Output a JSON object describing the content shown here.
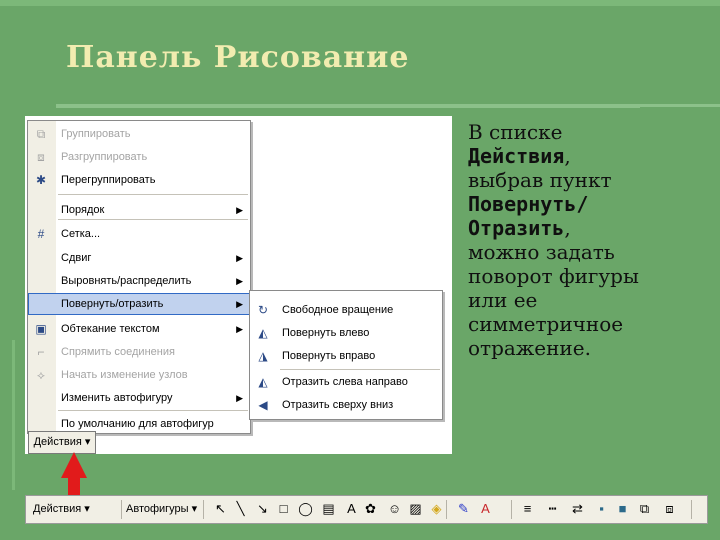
{
  "slide": {
    "title": "Панель Рисование",
    "description_lines": [
      {
        "text": "В списке",
        "bold": false
      },
      {
        "text": "Действия",
        "bold": true,
        "suffix": ","
      },
      {
        "text": "выбрав пункт",
        "bold": false
      },
      {
        "text": "Повернуть/",
        "bold": true
      },
      {
        "text": "Отразить",
        "bold": true,
        "suffix": ","
      },
      {
        "text": "можно задать",
        "bold": false
      },
      {
        "text": "поворот фигуры",
        "bold": false
      },
      {
        "text": "или ее",
        "bold": false
      },
      {
        "text": "симметричное",
        "bold": false
      },
      {
        "text": "отражение.",
        "bold": false
      }
    ]
  },
  "menu": {
    "items": [
      {
        "label": "Группировать",
        "icon": "group-icon",
        "glyph": "⧉",
        "disabled": true,
        "arrow": false
      },
      {
        "label": "Разгруппировать",
        "icon": "ungroup-icon",
        "glyph": "⧈",
        "disabled": true,
        "arrow": false
      },
      {
        "label": "Перегруппировать",
        "icon": "regroup-icon",
        "glyph": "✱",
        "disabled": false,
        "arrow": false
      },
      {
        "label": "Порядок",
        "icon": "",
        "glyph": "",
        "disabled": false,
        "arrow": true
      },
      {
        "label": "Сетка...",
        "icon": "grid-icon",
        "glyph": "#",
        "disabled": false,
        "arrow": false
      },
      {
        "label": "Сдвиг",
        "icon": "",
        "glyph": "",
        "disabled": false,
        "arrow": true
      },
      {
        "label": "Выровнять/распределить",
        "icon": "",
        "glyph": "",
        "disabled": false,
        "arrow": true
      },
      {
        "label": "Повернуть/отразить",
        "icon": "",
        "glyph": "",
        "disabled": false,
        "arrow": true,
        "highlighted": true
      },
      {
        "label": "Обтекание текстом",
        "icon": "text-wrap-icon",
        "glyph": "▣",
        "disabled": false,
        "arrow": true
      },
      {
        "label": "Спрямить соединения",
        "icon": "straighten-connectors-icon",
        "glyph": "⌐",
        "disabled": true,
        "arrow": false
      },
      {
        "label": "Начать изменение узлов",
        "icon": "edit-points-icon",
        "glyph": "⟡",
        "disabled": true,
        "arrow": false
      },
      {
        "label": "Изменить автофигуру",
        "icon": "",
        "glyph": "",
        "disabled": false,
        "arrow": true
      },
      {
        "label": "По умолчанию для автофигур",
        "icon": "",
        "glyph": "",
        "disabled": false,
        "arrow": false
      }
    ],
    "button_label": "Действия ▾"
  },
  "submenu": {
    "items": [
      {
        "label": "Свободное вращение",
        "icon": "free-rotate-icon",
        "glyph": "↻"
      },
      {
        "label": "Повернуть влево",
        "icon": "rotate-left-icon",
        "glyph": "◭"
      },
      {
        "label": "Повернуть вправо",
        "icon": "rotate-right-icon",
        "glyph": "◮"
      },
      {
        "label": "Отразить слева направо",
        "icon": "flip-horizontal-icon",
        "glyph": "◭"
      },
      {
        "label": "Отразить сверху вниз",
        "icon": "flip-vertical-icon",
        "glyph": "◀"
      }
    ]
  },
  "toolbar": {
    "actions_label": "Действия ▾",
    "autoshapes_label": "Автофигуры ▾",
    "icons": [
      {
        "name": "select-pointer-icon",
        "glyph": "↖"
      },
      {
        "name": "line-icon",
        "glyph": "╲"
      },
      {
        "name": "arrow-icon",
        "glyph": "↘"
      },
      {
        "name": "rectangle-icon",
        "glyph": "□"
      },
      {
        "name": "oval-icon",
        "glyph": "◯"
      },
      {
        "name": "text-box-icon",
        "glyph": "▤"
      },
      {
        "name": "wordart-icon",
        "glyph": "A"
      },
      {
        "name": "diagram-icon",
        "glyph": "✿"
      },
      {
        "name": "clipart-icon",
        "glyph": "☺"
      },
      {
        "name": "picture-icon",
        "glyph": "▨"
      },
      {
        "name": "fill-color-icon",
        "glyph": "◈"
      },
      {
        "name": "line-color-icon",
        "glyph": "✎"
      },
      {
        "name": "font-color-icon",
        "glyph": "A"
      },
      {
        "name": "line-style-icon",
        "glyph": "≡"
      },
      {
        "name": "dash-style-icon",
        "glyph": "┅"
      },
      {
        "name": "arrow-style-icon",
        "glyph": "⇄"
      },
      {
        "name": "shadow-icon",
        "glyph": "▪"
      },
      {
        "name": "3d-icon",
        "glyph": "■"
      },
      {
        "name": "group-icon",
        "glyph": "⧉"
      },
      {
        "name": "ungroup-icon",
        "glyph": "⧈"
      }
    ]
  },
  "colors": {
    "background": "#6aa668",
    "title": "#f2ecb0",
    "highlight": "#c1d2ee",
    "arrow": "#e11b1b"
  }
}
